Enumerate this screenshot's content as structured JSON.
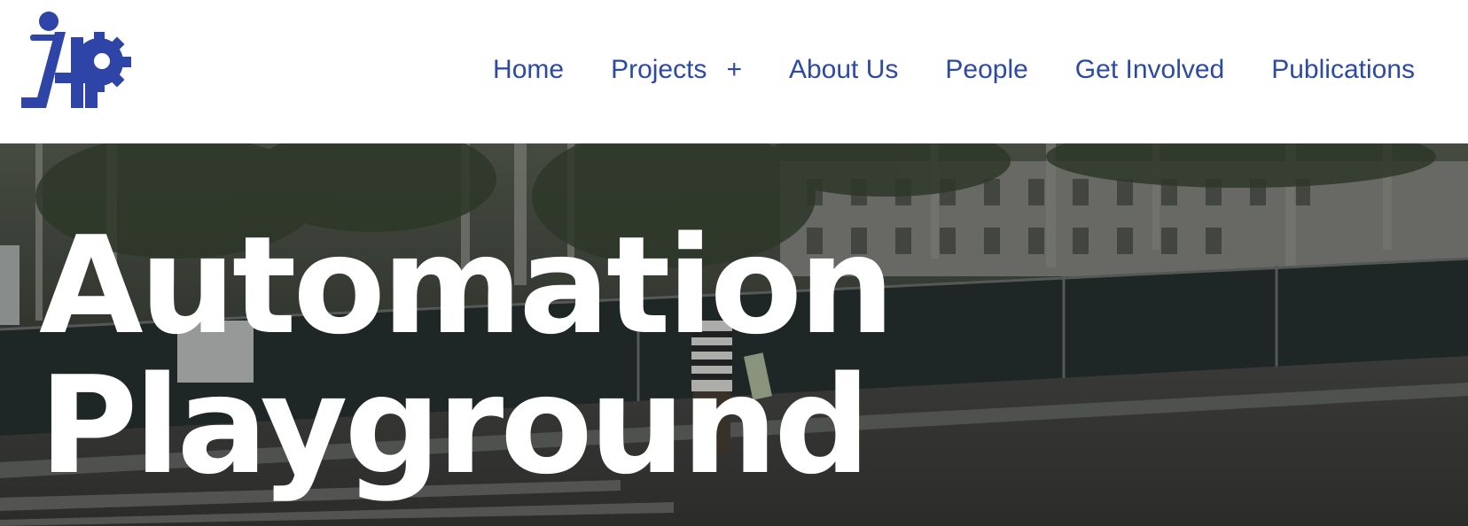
{
  "logo": {
    "icon": "iap-gear-runner-logo",
    "color": "#2e44a6"
  },
  "nav": {
    "items": [
      {
        "label": "Home"
      },
      {
        "label": "Projects",
        "icon": "plus-icon",
        "icon_glyph": "+"
      },
      {
        "label": "About Us"
      },
      {
        "label": "People"
      },
      {
        "label": "Get Involved"
      },
      {
        "label": "Publications"
      }
    ],
    "color": "#2d4aa3"
  },
  "hero": {
    "title_line1": "Automation",
    "title_line2": "Playground",
    "title_color": "#ffffff"
  }
}
